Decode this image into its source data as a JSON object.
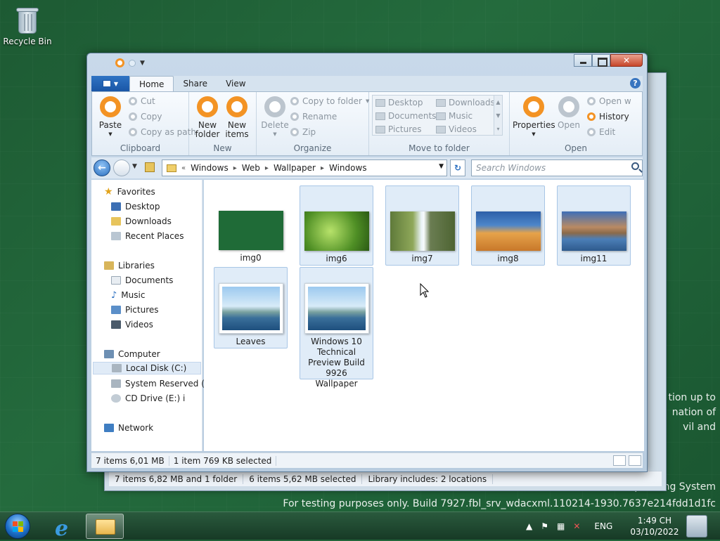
{
  "desktop": {
    "recycle_bin_label": "Recycle Bin",
    "watermark_partial": [
      "tion up to",
      "nation of",
      "vil and"
    ],
    "watermark_line1": "Microsoft Pre-release Windows Operating System",
    "watermark_line2": "For testing purposes only. Build 7927.fbl_srv_wdacxml.110214-1930.7637e214fdd1d1fc"
  },
  "background_window": {
    "status": [
      "7 items 6,82 MB and 1 folder",
      "6 items 5,62 MB selected",
      "Library includes:  2 locations"
    ]
  },
  "ribbon": {
    "tabs": [
      "Home",
      "Share",
      "View"
    ],
    "clipboard": {
      "paste": "Paste",
      "cut": "Cut",
      "copy": "Copy",
      "copy_as_path": "Copy as path",
      "label": "Clipboard"
    },
    "new": {
      "new_folder": "New folder",
      "new_items": "New items",
      "label": "New"
    },
    "organize": {
      "delete": "Delete",
      "copy_to_folder": "Copy to folder",
      "rename": "Rename",
      "zip": "Zip",
      "label": "Organize"
    },
    "move_to_folder": {
      "items": [
        "Desktop",
        "Downloads",
        "Documents",
        "Music",
        "Pictures",
        "Videos"
      ],
      "label": "Move to folder"
    },
    "open": {
      "properties": "Properties",
      "open": "Open",
      "open_with": "Open w",
      "history": "History",
      "edit": "Edit",
      "label": "Open"
    }
  },
  "address_bar": {
    "breadcrumb": [
      "Windows",
      "Web",
      "Wallpaper",
      "Windows"
    ],
    "search_placeholder": "Search Windows"
  },
  "nav_pane": {
    "favorites": {
      "label": "Favorites",
      "items": [
        "Desktop",
        "Downloads",
        "Recent Places"
      ]
    },
    "libraries": {
      "label": "Libraries",
      "items": [
        "Documents",
        "Music",
        "Pictures",
        "Videos"
      ]
    },
    "computer": {
      "label": "Computer",
      "items": [
        "Local Disk (C:)",
        "System Reserved (D:",
        "CD Drive (E:) i"
      ]
    },
    "network": {
      "label": "Network"
    }
  },
  "files": [
    {
      "name": "img0",
      "selected": false
    },
    {
      "name": "img6",
      "selected": true
    },
    {
      "name": "img7",
      "selected": true
    },
    {
      "name": "img8",
      "selected": true
    },
    {
      "name": "img11",
      "selected": true
    },
    {
      "name": "Leaves",
      "selected": true
    },
    {
      "name": "Windows 10 Technical Preview Build 9926 Wallpaper",
      "selected": true
    }
  ],
  "status_bar": {
    "count": "7 items 6,01 MB",
    "selection": "1 item 769 KB selected"
  },
  "taskbar": {
    "language": "ENG",
    "time": "1:49 CH",
    "date": "03/10/2022"
  },
  "colors": {
    "accent_orange": "#f39324",
    "selection_blue": "#e0ecf8",
    "desktop_green": "#246b3d"
  }
}
